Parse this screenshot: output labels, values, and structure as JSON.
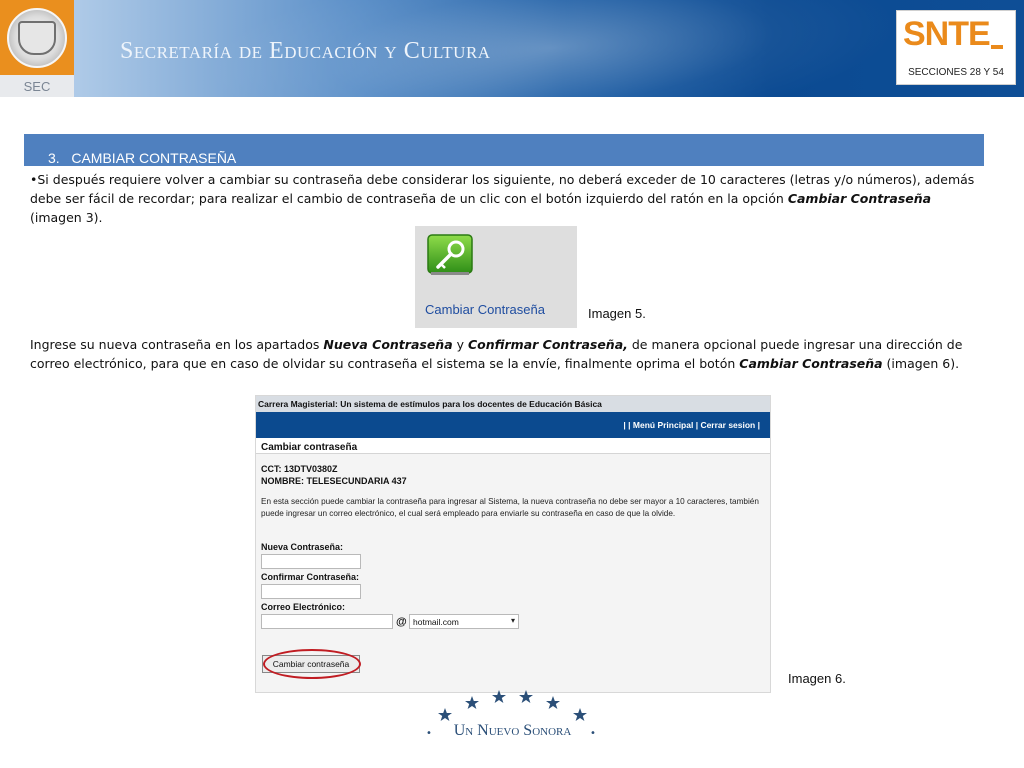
{
  "header": {
    "title": "Secretaría de Educación y Cultura",
    "left_logo_label": "SEC",
    "right_logo": {
      "name": "SNTE",
      "subtitle": "SECCIONES 28 Y 54"
    }
  },
  "section": {
    "number": "3.",
    "title": "CAMBIAR CONTRASEÑA"
  },
  "paragraph1": {
    "text_before": "•Si después requiere volver a cambiar su contraseña debe considerar los siguiente, no deberá exceder de 10 caracteres (letras y/o números), además debe ser fácil de recordar; para realizar el cambio de contraseña de un clic con el botón izquierdo del ratón en la opción ",
    "emphasis": "Cambiar Contraseña",
    "text_after": " (imagen 3)."
  },
  "image5": {
    "label": "Cambiar Contraseña",
    "caption": "Imagen 5.",
    "icon": "key-icon"
  },
  "paragraph2": {
    "t1": "Ingrese su nueva contraseña en los apartados ",
    "e1": "Nueva Contraseña",
    "t2": " y ",
    "e2": "Confirmar Contraseña,",
    "t3": " de manera opcional puede ingresar una dirección de correo electrónico, para que en caso de olvidar su contraseña el sistema se la envíe, finalmente oprima el botón ",
    "e3": "Cambiar Contraseña",
    "t4": " (imagen 6)."
  },
  "image6": {
    "caption": "Imagen 6.",
    "top_title": "Carrera Magisterial: Un sistema de estímulos para los docentes de Educación Básica",
    "nav_links": "|   | Menú Principal   | Cerrar sesion   |",
    "heading": "Cambiar contraseña",
    "cct": "CCT: 13DTV0380Z",
    "nombre": "NOMBRE: TELESECUNDARIA 437",
    "description": "En esta sección puede cambiar la contraseña para ingresar al Sistema, la nueva contraseña no debe ser mayor a 10 caracteres, también puede ingresar un correo electrónico, el cual será empleado para enviarle su contraseña en caso de que la olvide.",
    "new_password_label": "Nueva Contraseña:",
    "new_password_value": "",
    "confirm_password_label": "Confirmar Contraseña:",
    "confirm_password_value": "",
    "email_label": "Correo Electrónico:",
    "email_value": "",
    "at_symbol": "@",
    "domain_selected": "hotmail.com",
    "submit_label": "Cambiar contraseña"
  },
  "footer": {
    "text": "Un Nuevo Sonora",
    "dot": "•"
  },
  "colors": {
    "header_blue": "#0b4a92",
    "section_bar": "#4f80bf",
    "sec_orange": "#ea8f1e",
    "snte_orange": "#ea8a1b",
    "screenshot_nav": "#0b4a8f",
    "highlight_circle": "#c01c22",
    "footer_blue": "#2b4f78"
  }
}
